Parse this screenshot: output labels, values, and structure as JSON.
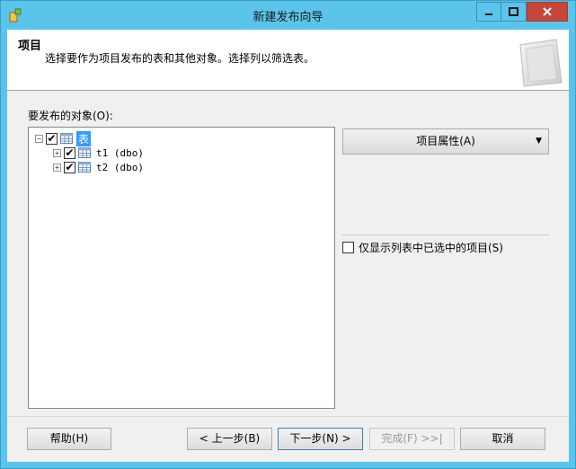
{
  "window": {
    "title": "新建发布向导"
  },
  "header": {
    "title": "项目",
    "description": "选择要作为项目发布的表和其他对象。选择列以筛选表。"
  },
  "objects_label": "要发布的对象(O):",
  "tree": {
    "root": {
      "label": "表",
      "expander": "−",
      "checked": true
    },
    "children": [
      {
        "label": "t1 (dbo)",
        "expander": "+",
        "checked": true
      },
      {
        "label": "t2 (dbo)",
        "expander": "+",
        "checked": true
      }
    ]
  },
  "properties_button": {
    "label": "项目属性(A)",
    "arrow": "▼"
  },
  "show_only_checkbox": {
    "label": "仅显示列表中已选中的项目(S)",
    "checked": false
  },
  "buttons": {
    "help": "帮助(H)",
    "back": "< 上一步(B)",
    "next": "下一步(N) >",
    "finish": "完成(F) >>|",
    "cancel": "取消"
  },
  "colors": {
    "titlebar": "#5bc4eb",
    "close": "#c7463a",
    "selection": "#3399ff"
  },
  "icons": {
    "check": "✔"
  }
}
